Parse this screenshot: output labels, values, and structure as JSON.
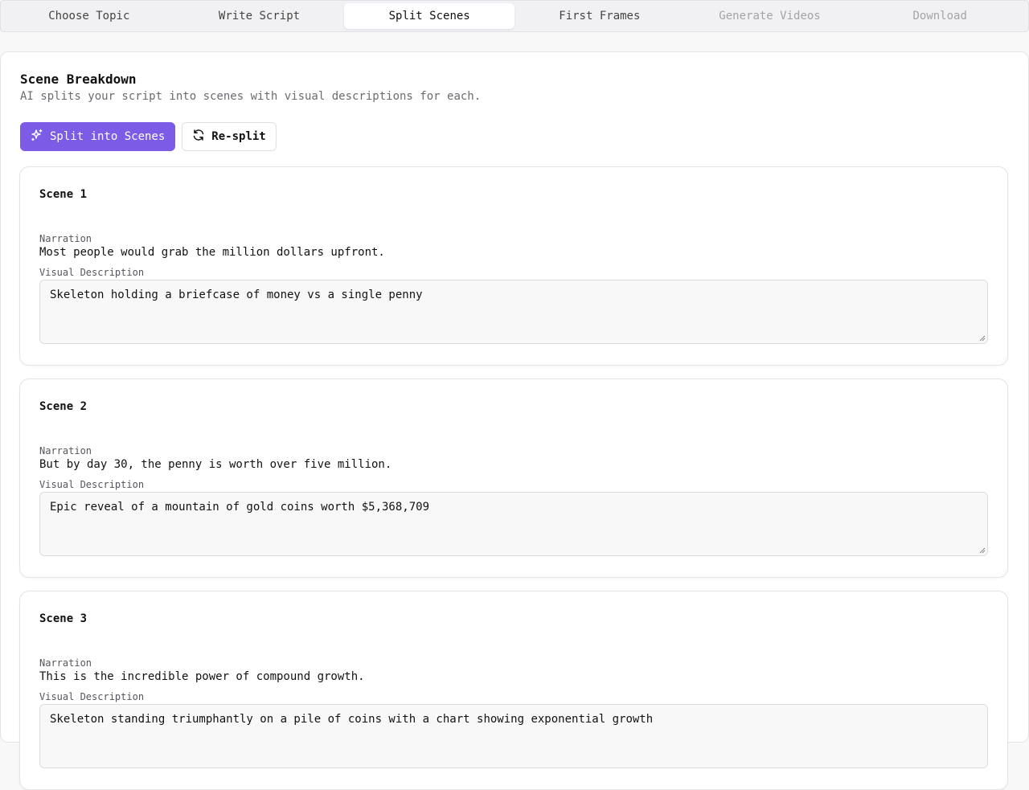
{
  "tabs": [
    {
      "label": "Choose Topic",
      "state": "normal"
    },
    {
      "label": "Write Script",
      "state": "normal"
    },
    {
      "label": "Split Scenes",
      "state": "active"
    },
    {
      "label": "First Frames",
      "state": "normal"
    },
    {
      "label": "Generate Videos",
      "state": "disabled"
    },
    {
      "label": "Download",
      "state": "disabled"
    }
  ],
  "main": {
    "title": "Scene Breakdown",
    "subtitle": "AI splits your script into scenes with visual descriptions for each.",
    "split_button": "Split into Scenes",
    "resplit_button": "Re-split"
  },
  "labels": {
    "narration": "Narration",
    "visual": "Visual Description"
  },
  "scenes": [
    {
      "title": "Scene 1",
      "narration": "Most people would grab the million dollars upfront.",
      "visual": "Skeleton holding a briefcase of money vs a single penny"
    },
    {
      "title": "Scene 2",
      "narration": "But by day 30, the penny is worth over five million.",
      "visual": "Epic reveal of a mountain of gold coins worth $5,368,709"
    },
    {
      "title": "Scene 3",
      "narration": "This is the incredible power of compound growth.",
      "visual": "Skeleton standing triumphantly on a pile of coins with a chart showing exponential growth"
    }
  ],
  "colors": {
    "accent": "#7c5ce6",
    "border": "#e4e4e7",
    "muted_text": "#6b6b72"
  },
  "icons": {
    "split": "sparkles-icon",
    "resplit": "refresh-icon"
  }
}
